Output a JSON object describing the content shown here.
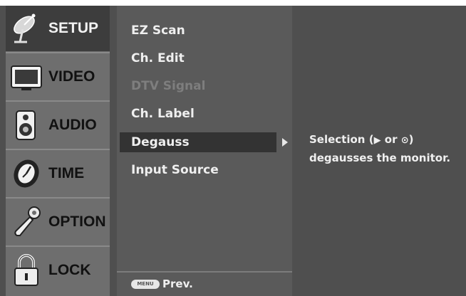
{
  "categories": [
    {
      "label": "SETUP",
      "icon": "satellite-dish-icon",
      "selected": true
    },
    {
      "label": "VIDEO",
      "icon": "tv-screen-icon",
      "selected": false
    },
    {
      "label": "AUDIO",
      "icon": "speaker-icon",
      "selected": false
    },
    {
      "label": "TIME",
      "icon": "clock-icon",
      "selected": false
    },
    {
      "label": "OPTION",
      "icon": "wrench-icon",
      "selected": false
    },
    {
      "label": "LOCK",
      "icon": "padlock-icon",
      "selected": false
    }
  ],
  "submenu": {
    "items": [
      {
        "label": "EZ Scan",
        "enabled": true
      },
      {
        "label": "Ch. Edit",
        "enabled": true
      },
      {
        "label": "DTV Signal",
        "enabled": false
      },
      {
        "label": "Ch. Label",
        "enabled": true
      },
      {
        "label": "Degauss",
        "enabled": true,
        "highlighted": true
      },
      {
        "label": "Input Source",
        "enabled": true
      }
    ],
    "footer": {
      "key_label": "MENU",
      "text": "Prev."
    }
  },
  "description": {
    "line1_prefix": "Selection (",
    "right_symbol": "▶",
    "or_text": " or ",
    "enter_symbol": "⊙",
    "line1_suffix": ")",
    "line2": "degausses the monitor."
  }
}
